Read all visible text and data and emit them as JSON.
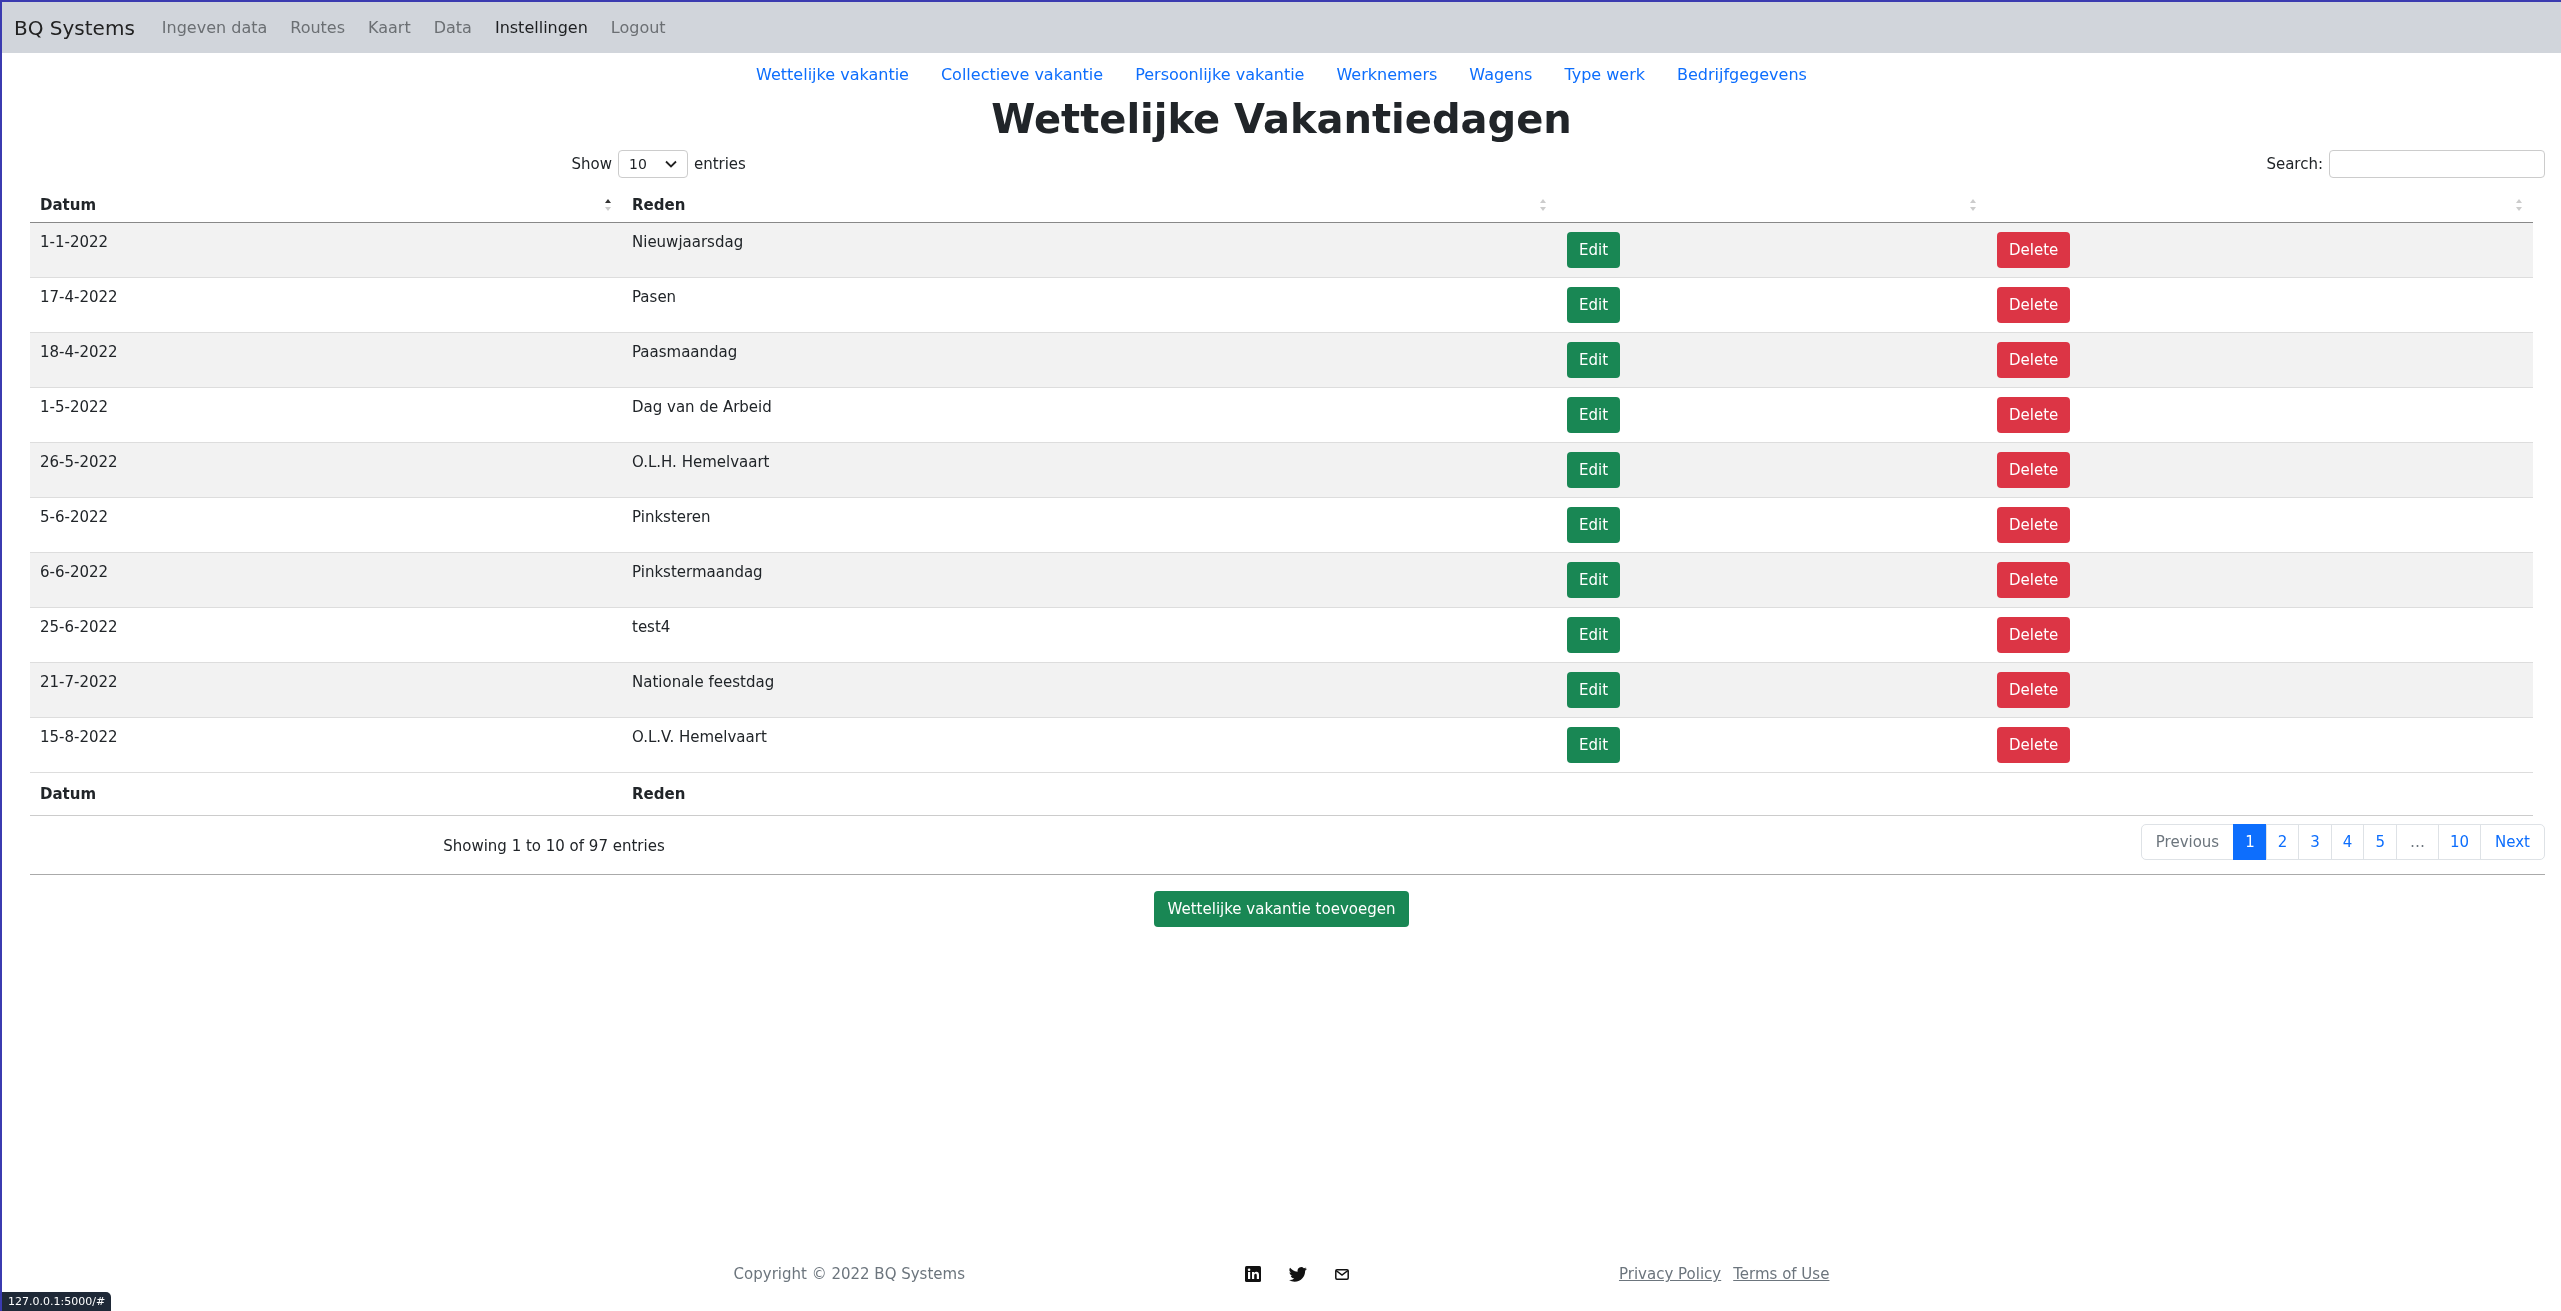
{
  "navbar": {
    "brand": "BQ Systems",
    "items": [
      {
        "label": "Ingeven data",
        "selected": false
      },
      {
        "label": "Routes",
        "selected": false
      },
      {
        "label": "Kaart",
        "selected": false
      },
      {
        "label": "Data",
        "selected": false
      },
      {
        "label": "Instellingen",
        "selected": true
      },
      {
        "label": "Logout",
        "selected": false
      }
    ]
  },
  "subnav": [
    "Wettelijke vakantie",
    "Collectieve vakantie",
    "Persoonlijke vakantie",
    "Werknemers",
    "Wagens",
    "Type werk",
    "Bedrijfgegevens"
  ],
  "title": "Wettelijke Vakantiedagen",
  "length_menu": {
    "before": "Show",
    "value": "10",
    "after": "entries"
  },
  "search": {
    "label": "Search:"
  },
  "table": {
    "columns": [
      {
        "label": "Datum",
        "sorted_ascending": true
      },
      {
        "label": "Reden",
        "sorted_ascending": false
      },
      {
        "sorted_ascending": false
      },
      {
        "sorted_ascending": false
      }
    ],
    "rows": [
      {
        "datum": "1-1-2022",
        "reden": "Nieuwjaarsdag",
        "edit": "Edit",
        "delete": "Delete"
      },
      {
        "datum": "17-4-2022",
        "reden": "Pasen",
        "edit": "Edit",
        "delete": "Delete"
      },
      {
        "datum": "18-4-2022",
        "reden": "Paasmaandag",
        "edit": "Edit",
        "delete": "Delete"
      },
      {
        "datum": "1-5-2022",
        "reden": "Dag van de Arbeid",
        "edit": "Edit",
        "delete": "Delete"
      },
      {
        "datum": "26-5-2022",
        "reden": "O.L.H. Hemelvaart",
        "edit": "Edit",
        "delete": "Delete"
      },
      {
        "datum": "5-6-2022",
        "reden": "Pinksteren",
        "edit": "Edit",
        "delete": "Delete"
      },
      {
        "datum": "6-6-2022",
        "reden": "Pinkstermaandag",
        "edit": "Edit",
        "delete": "Delete"
      },
      {
        "datum": "25-6-2022",
        "reden": "test4",
        "edit": "Edit",
        "delete": "Delete"
      },
      {
        "datum": "21-7-2022",
        "reden": "Nationale feestdag",
        "edit": "Edit",
        "delete": "Delete"
      },
      {
        "datum": "15-8-2022",
        "reden": "O.L.V. Hemelvaart",
        "edit": "Edit",
        "delete": "Delete"
      }
    ],
    "footer": [
      "Datum",
      "Reden"
    ]
  },
  "info": "Showing 1 to 10 of 97 entries",
  "pagination": [
    {
      "label": "Previous",
      "kind": "nav",
      "selected": false,
      "disabled": true
    },
    {
      "label": "1",
      "kind": "page",
      "selected": true,
      "disabled": false
    },
    {
      "label": "2",
      "kind": "page",
      "selected": false,
      "disabled": false
    },
    {
      "label": "3",
      "kind": "page",
      "selected": false,
      "disabled": false
    },
    {
      "label": "4",
      "kind": "page",
      "selected": false,
      "disabled": false
    },
    {
      "label": "5",
      "kind": "page",
      "selected": false,
      "disabled": false
    },
    {
      "label": "…",
      "kind": "ellipsis",
      "selected": false,
      "disabled": true
    },
    {
      "label": "10",
      "kind": "page",
      "selected": false,
      "disabled": false
    },
    {
      "label": "Next",
      "kind": "nav",
      "selected": false,
      "disabled": false
    }
  ],
  "add_button": "Wettelijke vakantie toevoegen",
  "page_footer": {
    "copyright": "Copyright © 2022 BQ Systems",
    "links": [
      "Privacy Policy",
      "Terms of Use"
    ]
  },
  "status_url": "127.0.0.1:5000/#"
}
